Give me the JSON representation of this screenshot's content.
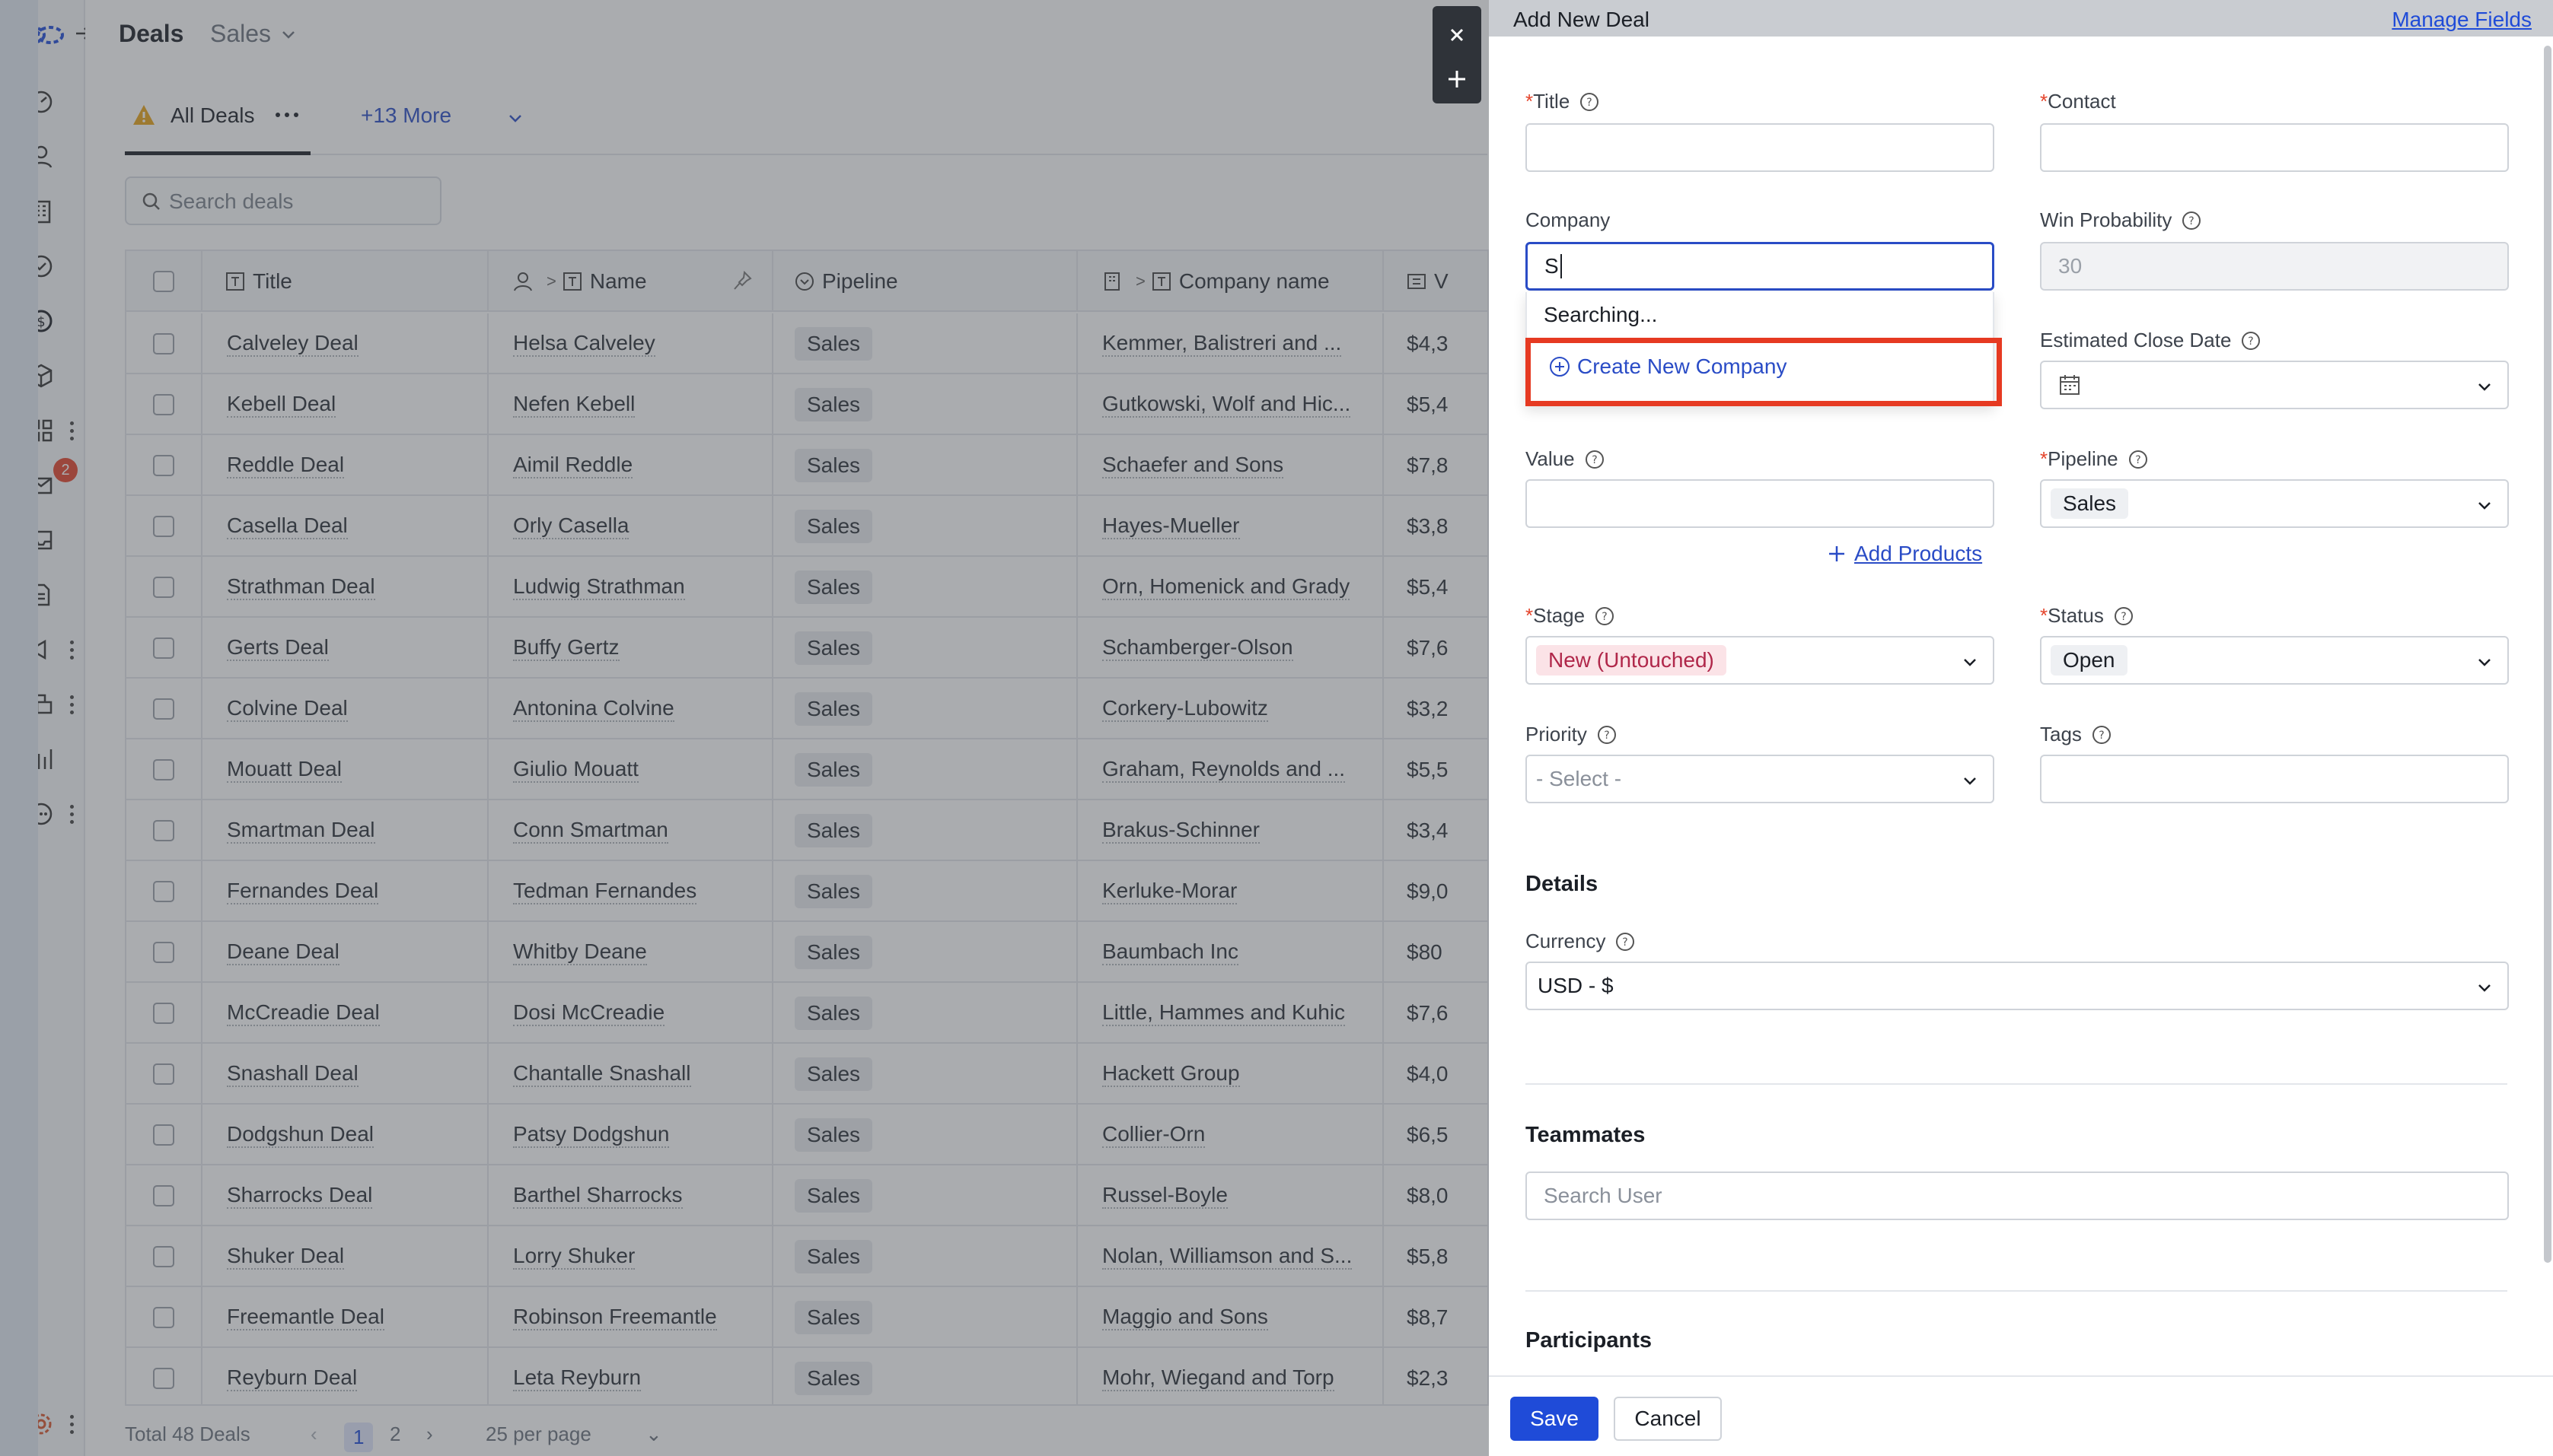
{
  "app": {
    "page_title": "Deals",
    "pipeline_switch": "Sales",
    "mail_badge": "2"
  },
  "tabs": {
    "current": "All Deals",
    "more": "+13 More"
  },
  "search": {
    "placeholder": "Search deals"
  },
  "table": {
    "columns": [
      "Title",
      "Name",
      "Pipeline",
      "Company name",
      "V"
    ],
    "rows": [
      {
        "title": "Calveley Deal",
        "name": "Helsa Calveley",
        "pipeline": "Sales",
        "company": "Kemmer, Balistreri and ...",
        "value": "$4,3"
      },
      {
        "title": "Kebell Deal",
        "name": "Nefen Kebell",
        "pipeline": "Sales",
        "company": "Gutkowski, Wolf and Hic...",
        "value": "$5,4"
      },
      {
        "title": "Reddle Deal",
        "name": "Aimil Reddle",
        "pipeline": "Sales",
        "company": "Schaefer and Sons",
        "value": "$7,8"
      },
      {
        "title": "Casella Deal",
        "name": "Orly Casella",
        "pipeline": "Sales",
        "company": "Hayes-Mueller",
        "value": "$3,8"
      },
      {
        "title": "Strathman Deal",
        "name": "Ludwig Strathman",
        "pipeline": "Sales",
        "company": "Orn, Homenick and Grady",
        "value": "$5,4"
      },
      {
        "title": "Gerts Deal",
        "name": "Buffy Gertz",
        "pipeline": "Sales",
        "company": "Schamberger-Olson",
        "value": "$7,6"
      },
      {
        "title": "Colvine Deal",
        "name": "Antonina Colvine",
        "pipeline": "Sales",
        "company": "Corkery-Lubowitz",
        "value": "$3,2"
      },
      {
        "title": "Mouatt Deal",
        "name": "Giulio Mouatt",
        "pipeline": "Sales",
        "company": "Graham, Reynolds and ...",
        "value": "$5,5"
      },
      {
        "title": "Smartman Deal",
        "name": "Conn Smartman",
        "pipeline": "Sales",
        "company": "Brakus-Schinner",
        "value": "$3,4"
      },
      {
        "title": "Fernandes Deal",
        "name": "Tedman Fernandes",
        "pipeline": "Sales",
        "company": "Kerluke-Morar",
        "value": "$9,0"
      },
      {
        "title": "Deane Deal",
        "name": "Whitby Deane",
        "pipeline": "Sales",
        "company": "Baumbach Inc",
        "value": "$80"
      },
      {
        "title": "McCreadie Deal",
        "name": "Dosi McCreadie",
        "pipeline": "Sales",
        "company": "Little, Hammes and Kuhic",
        "value": "$7,6"
      },
      {
        "title": "Snashall Deal",
        "name": "Chantalle Snashall",
        "pipeline": "Sales",
        "company": "Hackett Group",
        "value": "$4,0"
      },
      {
        "title": "Dodgshun Deal",
        "name": "Patsy Dodgshun",
        "pipeline": "Sales",
        "company": "Collier-Orn",
        "value": "$6,5"
      },
      {
        "title": "Sharrocks Deal",
        "name": "Barthel Sharrocks",
        "pipeline": "Sales",
        "company": "Russel-Boyle",
        "value": "$8,0"
      },
      {
        "title": "Shuker Deal",
        "name": "Lorry Shuker",
        "pipeline": "Sales",
        "company": "Nolan, Williamson and S...",
        "value": "$5,8"
      },
      {
        "title": "Freemantle Deal",
        "name": "Robinson Freemantle",
        "pipeline": "Sales",
        "company": "Maggio and Sons",
        "value": "$8,7"
      },
      {
        "title": "Reyburn Deal",
        "name": "Leta Reyburn",
        "pipeline": "Sales",
        "company": "Mohr, Wiegand and Torp",
        "value": "$2,3"
      }
    ]
  },
  "footer": {
    "total": "Total 48 Deals",
    "page_1": "1",
    "page_2": "2",
    "per_page": "25 per page"
  },
  "drawer": {
    "title": "Add New Deal",
    "manage_fields": "Manage Fields",
    "required_mark": "*",
    "fields": {
      "title_label": "Title",
      "contact_label": "Contact",
      "company_label": "Company",
      "company_value": "S",
      "win_probability_label": "Win Probability",
      "win_probability_value": "30",
      "estimated_close_label": "Estimated Close Date",
      "value_label": "Value",
      "pipeline_label": "Pipeline",
      "pipeline_value": "Sales",
      "stage_label": "Stage",
      "stage_value": "New (Untouched)",
      "status_label": "Status",
      "status_value": "Open",
      "priority_label": "Priority",
      "priority_value": "- Select -",
      "tags_label": "Tags",
      "currency_label": "Currency",
      "currency_value": "USD - $",
      "teammates_placeholder": "Search User"
    },
    "company_dropdown": {
      "searching": "Searching...",
      "create_new": "Create New Company"
    },
    "add_products": "Add Products",
    "sections": {
      "details": "Details",
      "teammates": "Teammates",
      "participants": "Participants"
    },
    "buttons": {
      "save": "Save",
      "cancel": "Cancel"
    }
  },
  "colors": {
    "accent": "#1f4bd8",
    "highlight": "#e63a22",
    "stage_tag": "#fbe3e7"
  },
  "icons": [
    "logo-icon",
    "dashboard-icon",
    "contacts-icon",
    "companies-icon",
    "tasks-icon",
    "deals-icon",
    "products-icon",
    "apps-icon",
    "mail-icon",
    "inbox-icon",
    "documents-icon",
    "campaigns-icon",
    "chat-icon",
    "reports-icon",
    "more-icon",
    "settings-icon",
    "search-icon",
    "help-icon",
    "calendar-icon",
    "close-icon",
    "minimize-icon"
  ]
}
